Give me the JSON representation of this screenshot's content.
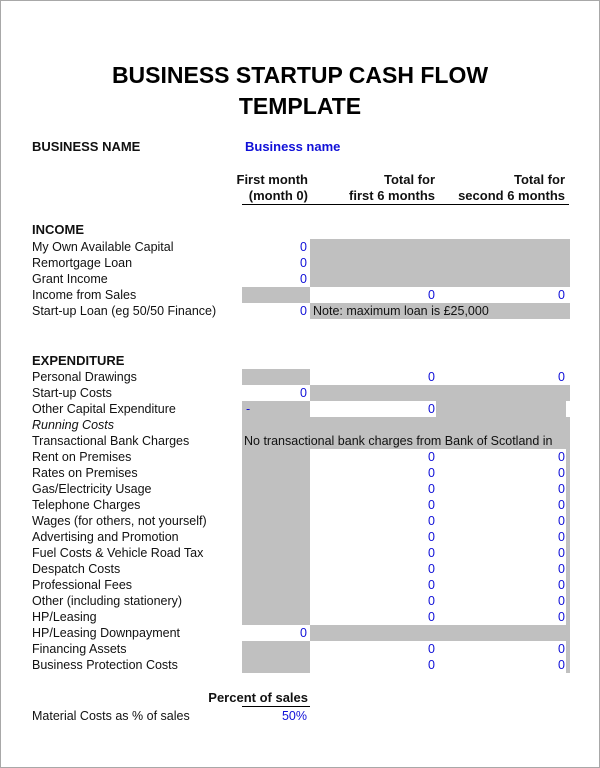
{
  "title": {
    "line1": "BUSINESS STARTUP CASH FLOW",
    "line2": "TEMPLATE"
  },
  "business": {
    "label": "BUSINESS NAME",
    "value": "Business name"
  },
  "columns": {
    "col1": {
      "line1": "First month",
      "line2": "(month 0)"
    },
    "col2": {
      "line1": "Total for",
      "line2": "first 6 months"
    },
    "col3": {
      "line1": "Total for",
      "line2": "second 6 months"
    }
  },
  "income": {
    "heading": "INCOME",
    "rows": [
      {
        "label": "My Own Available Capital",
        "col1": "0"
      },
      {
        "label": "Remortgage Loan",
        "col1": "0"
      },
      {
        "label": "Grant Income",
        "col1": "0"
      },
      {
        "label": "Income from Sales",
        "col2": "0",
        "col3": "0"
      },
      {
        "label": "Start-up Loan (eg 50/50 Finance)",
        "col1": "0",
        "note": "Note: maximum loan is £25,000"
      }
    ]
  },
  "expenditure": {
    "heading": "EXPENDITURE",
    "rows": [
      {
        "label": "Personal Drawings",
        "col2": "0",
        "col3": "0"
      },
      {
        "label": "Start-up Costs",
        "col1": "0"
      },
      {
        "label": "Other Capital Expenditure",
        "col1": "-",
        "col2": "0"
      },
      {
        "label": "Running Costs"
      },
      {
        "label": "Transactional Bank Charges",
        "note": "No transactional bank charges from Bank of Scotland in"
      },
      {
        "label": "Rent on Premises",
        "col2": "0",
        "col3": "0"
      },
      {
        "label": "Rates on Premises",
        "col2": "0",
        "col3": "0"
      },
      {
        "label": "Gas/Electricity Usage",
        "col2": "0",
        "col3": "0"
      },
      {
        "label": "Telephone Charges",
        "col2": "0",
        "col3": "0"
      },
      {
        "label": "Wages (for others, not yourself)",
        "col2": "0",
        "col3": "0"
      },
      {
        "label": "Advertising and Promotion",
        "col2": "0",
        "col3": "0"
      },
      {
        "label": "Fuel Costs & Vehicle Road Tax",
        "col2": "0",
        "col3": "0"
      },
      {
        "label": "Despatch Costs",
        "col2": "0",
        "col3": "0"
      },
      {
        "label": "Professional Fees",
        "col2": "0",
        "col3": "0"
      },
      {
        "label": "Other (including stationery)",
        "col2": "0",
        "col3": "0"
      },
      {
        "label": "HP/Leasing",
        "col2": "0",
        "col3": "0"
      },
      {
        "label": "HP/Leasing Downpayment",
        "col1": "0"
      },
      {
        "label": "Financing Assets",
        "col2": "0",
        "col3": "0"
      },
      {
        "label": "Business Protection Costs",
        "col2": "0",
        "col3": "0"
      }
    ]
  },
  "percent": {
    "header": "Percent of sales",
    "label": "Material Costs as % of sales",
    "value": "50%"
  }
}
